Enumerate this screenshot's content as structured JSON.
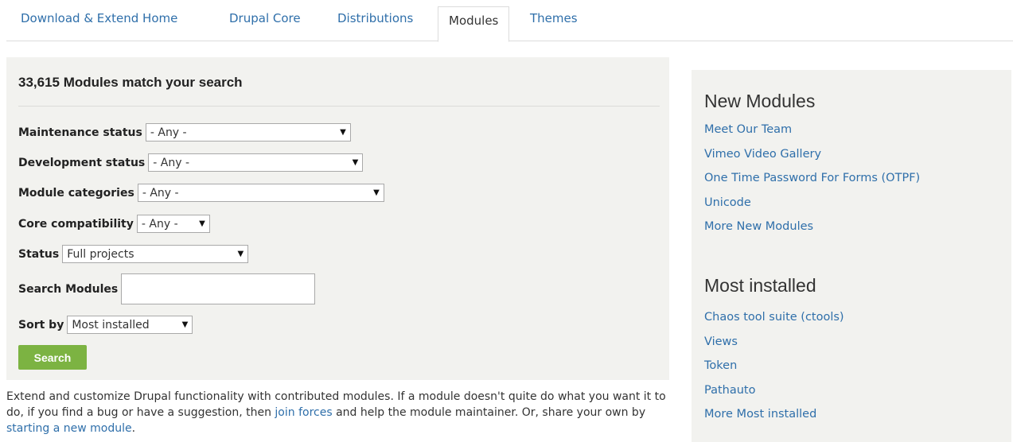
{
  "tabs": [
    {
      "label": "Download & Extend Home"
    },
    {
      "label": "Drupal Core"
    },
    {
      "label": "Distributions"
    },
    {
      "label": "Modules"
    },
    {
      "label": "Themes"
    }
  ],
  "search": {
    "title": "33,615 Modules match your search",
    "filters": {
      "maintenance": {
        "label": "Maintenance status",
        "value": "- Any -"
      },
      "development": {
        "label": "Development status",
        "value": "- Any -"
      },
      "categories": {
        "label": "Module categories",
        "value": "- Any -"
      },
      "core": {
        "label": "Core compatibility",
        "value": "- Any -"
      },
      "status": {
        "label": "Status",
        "value": "Full projects"
      },
      "search": {
        "label": "Search Modules",
        "value": ""
      },
      "sort": {
        "label": "Sort by",
        "value": "Most installed"
      }
    },
    "dropdown_arrow": "▼",
    "button_label": "Search"
  },
  "description": {
    "part1": "Extend and customize Drupal functionality with contributed modules. If a module doesn't quite do what you want it to do, if you find a bug or have a suggestion, then ",
    "link1": "join forces",
    "part2": " and help the module maintainer. Or, share your own by ",
    "link2": "starting a new module",
    "part3": "."
  },
  "sidebar": {
    "new_modules": {
      "title": "New Modules",
      "items": [
        "Meet Our Team",
        "Vimeo Video Gallery",
        "One Time Password For Forms (OTPF)",
        "Unicode",
        "More New Modules"
      ]
    },
    "most_installed": {
      "title": "Most installed",
      "items": [
        "Chaos tool suite (ctools)",
        "Views",
        "Token",
        "Pathauto",
        "More Most installed"
      ]
    }
  },
  "colors": {
    "link": "#2f6faa",
    "button": "#7cb342",
    "panel": "#f2f2ef"
  }
}
